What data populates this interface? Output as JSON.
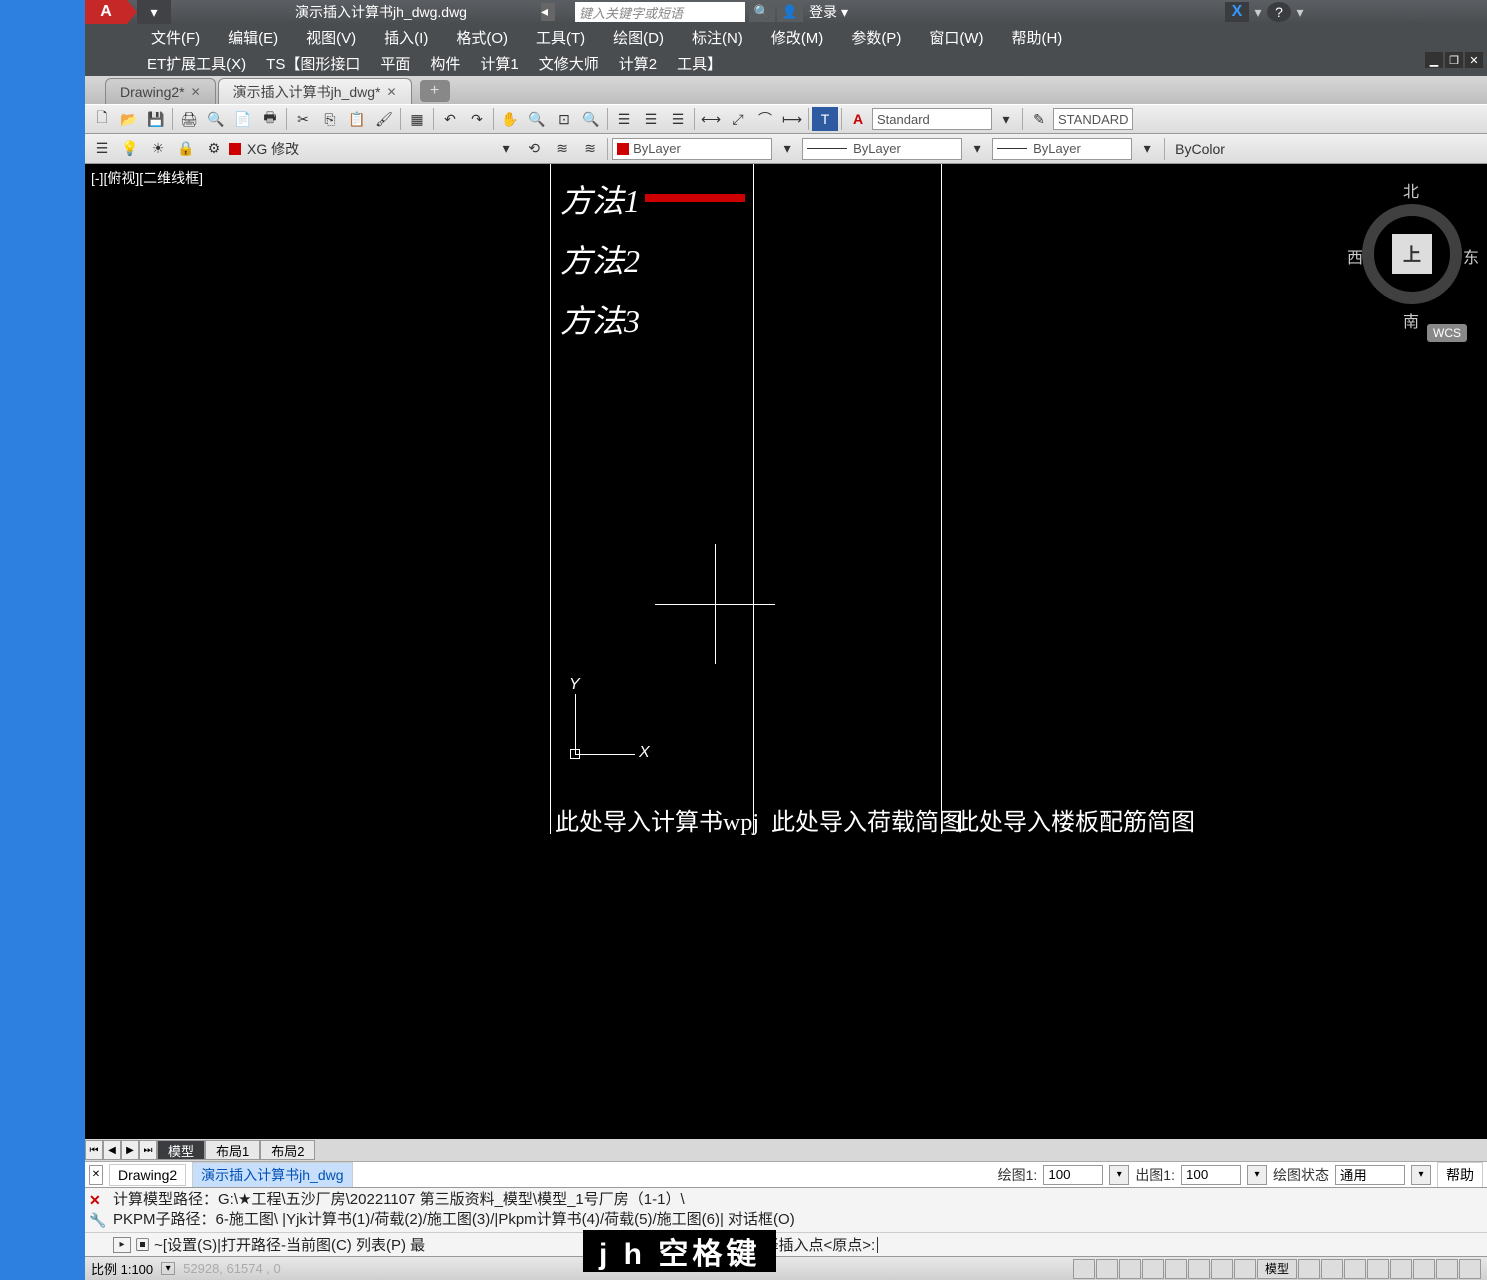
{
  "titlebar": {
    "logo": "A",
    "title": "演示插入计算书jh_dwg.dwg",
    "search_placeholder": "键入关键字或短语",
    "login": "登录",
    "x_btn": "X",
    "help_btn": "?",
    "min": "—",
    "max": "□",
    "close": "✕"
  },
  "menus": {
    "row1": [
      "文件(F)",
      "编辑(E)",
      "视图(V)",
      "插入(I)",
      "格式(O)",
      "工具(T)",
      "绘图(D)",
      "标注(N)",
      "修改(M)",
      "参数(P)",
      "窗口(W)",
      "帮助(H)"
    ],
    "row2": [
      "ET扩展工具(X)",
      "TS【图形接口",
      "平面",
      "构件",
      "计算1",
      "文修大师",
      "计算2",
      "工具】"
    ]
  },
  "doctabs": {
    "tab1": "Drawing2*",
    "tab2": "演示插入计算书jh_dwg*"
  },
  "toolbar1": {
    "style_select": "Standard",
    "style_select2": "STANDARD"
  },
  "toolbar2": {
    "xg_label": "XG 修改",
    "layer_color": "ByLayer",
    "layer_ltype": "ByLayer",
    "layer_lweight": "ByLayer",
    "bycolor": "ByColor"
  },
  "drawing": {
    "viewport_label": "[-][俯视][二维线框]",
    "method1": "方法1",
    "method2": "方法2",
    "method3": "方法3",
    "ucs_x": "X",
    "ucs_y": "Y",
    "import1": "此处导入计算书wpj",
    "import2": "此处导入荷载简图",
    "import3": "此处导入楼板配筋简图"
  },
  "viewcube": {
    "north": "北",
    "south": "南",
    "east": "东",
    "west": "西",
    "top": "上",
    "wcs": "WCS"
  },
  "layout_tabs": {
    "model": "模型",
    "layout1": "布局1",
    "layout2": "布局2"
  },
  "status_row": {
    "tab1": "Drawing2",
    "tab2": "演示插入计算书jh_dwg",
    "draw1_label": "绘图1:",
    "draw1_val": "100",
    "out1_label": "出图1:",
    "out1_val": "100",
    "state_label": "绘图状态",
    "state_val": "通用",
    "help": "帮助"
  },
  "command": {
    "line1": "计算模型路径：G:\\★工程\\五沙厂房\\20221107 第三版资料_模型\\模型_1号厂房（1-1）\\",
    "line2": "PKPM子路径：6-施工图\\ |Yjk计算书(1)/荷载(2)/施工图(3)/|Pkpm计算书(4)/荷载(5)/施工图(6)|   对话框(O)",
    "prompt_prefix": "▣ ~[设置(S)|打开路径-当前图(C) 列表(P) 最",
    "prompt_suffix": "路径(B) 退出(E)]请选择插入点<原点>:"
  },
  "keylabel": "j h 空格键",
  "statusbar": {
    "scale": "比例 1:100",
    "coords": "52928, 61574 , 0",
    "model_btn": "模型"
  }
}
